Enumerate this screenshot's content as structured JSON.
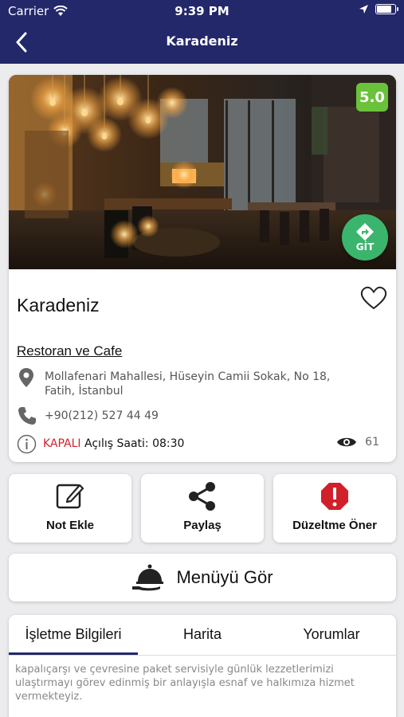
{
  "status_bar": {
    "carrier": "Carrier",
    "time": "9:39 PM",
    "battery_level": 0.9
  },
  "nav": {
    "title": "Karadeniz"
  },
  "restaurant": {
    "rating": "5.0",
    "go_label": "GİT",
    "name": "Karadeniz",
    "category": "Restoran ve Cafe",
    "address": "Mollafenari Mahallesi, Hüseyin Camii Sokak, No 18, Fatih, İstanbul",
    "phone": "+90(212) 527 44 49",
    "status_closed": "KAPALI",
    "opening": "Açılış Saati: 08:30",
    "views": "61",
    "favorited": false
  },
  "actions": [
    {
      "label": "Not Ekle",
      "icon": "edit-icon"
    },
    {
      "label": "Paylaş",
      "icon": "share-icon"
    },
    {
      "label": "Düzeltme Öner",
      "icon": "alert-icon"
    }
  ],
  "menu_button": {
    "label": "Menüyü Gör",
    "icon": "cloche-icon"
  },
  "tabs": [
    {
      "label": "İşletme Bilgileri",
      "active": true
    },
    {
      "label": "Harita",
      "active": false
    },
    {
      "label": "Yorumlar",
      "active": false
    }
  ],
  "description": "kapalıçarşı ve çevresine paket servisiyle günlük lezzetlerimizi ulaştırmayı görev edinmiş bir anlayışla esnaf ve halkımıza hizmet vermekteyiz.",
  "colors": {
    "header": "#23286b",
    "rating": "#6ac23b",
    "go": "#3bb56d",
    "closed": "#d0202a",
    "alert": "#d0202a"
  }
}
